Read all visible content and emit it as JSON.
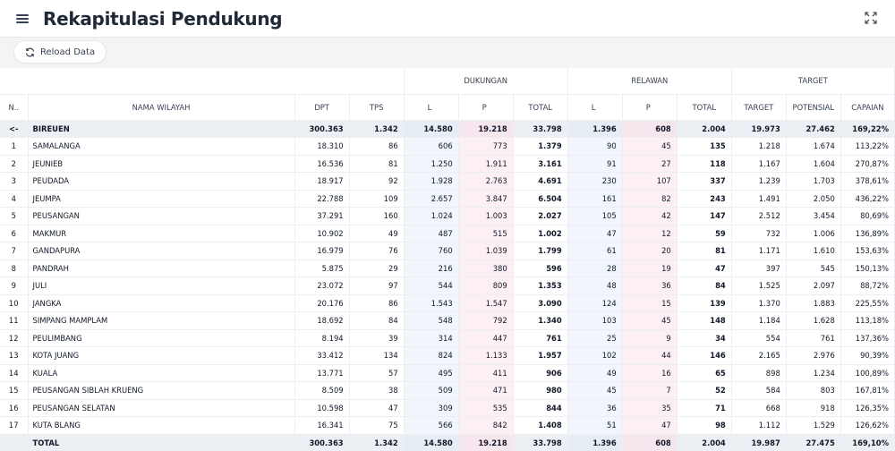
{
  "header": {
    "title": "Rekapitulasi Pendukung"
  },
  "toolbar": {
    "reload_label": "Reload Data"
  },
  "table": {
    "groups": {
      "dukungan": "DUKUNGAN",
      "relawan": "RELAWAN",
      "target": "TARGET"
    },
    "columns": {
      "no": "N..",
      "nama": "NAMA WILAYAH",
      "dpt": "DPT",
      "tps": "TPS",
      "d_l": "L",
      "d_p": "P",
      "d_total": "TOTAL",
      "r_l": "L",
      "r_p": "P",
      "r_total": "TOTAL",
      "target": "TARGET",
      "potensial": "POTENSIAL",
      "capaian": "CAPAIAN"
    },
    "group_row": {
      "toggle": "<-",
      "name": "BIREUEN",
      "dpt": "300.363",
      "tps": "1.342",
      "d_l": "14.580",
      "d_p": "19.218",
      "d_total": "33.798",
      "r_l": "1.396",
      "r_p": "608",
      "r_total": "2.004",
      "target": "19.973",
      "potensial": "27.462",
      "capaian": "169,22%"
    },
    "rows": [
      {
        "no": "1",
        "name": "SAMALANGA",
        "dpt": "18.310",
        "tps": "86",
        "d_l": "606",
        "d_p": "773",
        "d_total": "1.379",
        "r_l": "90",
        "r_p": "45",
        "r_total": "135",
        "target": "1.218",
        "potensial": "1.674",
        "capaian": "113,22%"
      },
      {
        "no": "2",
        "name": "JEUNIEB",
        "dpt": "16.536",
        "tps": "81",
        "d_l": "1.250",
        "d_p": "1.911",
        "d_total": "3.161",
        "r_l": "91",
        "r_p": "27",
        "r_total": "118",
        "target": "1.167",
        "potensial": "1.604",
        "capaian": "270,87%"
      },
      {
        "no": "3",
        "name": "PEUDADA",
        "dpt": "18.917",
        "tps": "92",
        "d_l": "1.928",
        "d_p": "2.763",
        "d_total": "4.691",
        "r_l": "230",
        "r_p": "107",
        "r_total": "337",
        "target": "1.239",
        "potensial": "1.703",
        "capaian": "378,61%"
      },
      {
        "no": "4",
        "name": "JEUMPA",
        "dpt": "22.788",
        "tps": "109",
        "d_l": "2.657",
        "d_p": "3.847",
        "d_total": "6.504",
        "r_l": "161",
        "r_p": "82",
        "r_total": "243",
        "target": "1.491",
        "potensial": "2.050",
        "capaian": "436,22%"
      },
      {
        "no": "5",
        "name": "PEUSANGAN",
        "dpt": "37.291",
        "tps": "160",
        "d_l": "1.024",
        "d_p": "1.003",
        "d_total": "2.027",
        "r_l": "105",
        "r_p": "42",
        "r_total": "147",
        "target": "2.512",
        "potensial": "3.454",
        "capaian": "80,69%"
      },
      {
        "no": "6",
        "name": "MAKMUR",
        "dpt": "10.902",
        "tps": "49",
        "d_l": "487",
        "d_p": "515",
        "d_total": "1.002",
        "r_l": "47",
        "r_p": "12",
        "r_total": "59",
        "target": "732",
        "potensial": "1.006",
        "capaian": "136,89%"
      },
      {
        "no": "7",
        "name": "GANDAPURA",
        "dpt": "16.979",
        "tps": "76",
        "d_l": "760",
        "d_p": "1.039",
        "d_total": "1.799",
        "r_l": "61",
        "r_p": "20",
        "r_total": "81",
        "target": "1.171",
        "potensial": "1.610",
        "capaian": "153,63%"
      },
      {
        "no": "8",
        "name": "PANDRAH",
        "dpt": "5.875",
        "tps": "29",
        "d_l": "216",
        "d_p": "380",
        "d_total": "596",
        "r_l": "28",
        "r_p": "19",
        "r_total": "47",
        "target": "397",
        "potensial": "545",
        "capaian": "150,13%"
      },
      {
        "no": "9",
        "name": "JULI",
        "dpt": "23.072",
        "tps": "97",
        "d_l": "544",
        "d_p": "809",
        "d_total": "1.353",
        "r_l": "48",
        "r_p": "36",
        "r_total": "84",
        "target": "1.525",
        "potensial": "2.097",
        "capaian": "88,72%"
      },
      {
        "no": "10",
        "name": "JANGKA",
        "dpt": "20.176",
        "tps": "86",
        "d_l": "1.543",
        "d_p": "1.547",
        "d_total": "3.090",
        "r_l": "124",
        "r_p": "15",
        "r_total": "139",
        "target": "1.370",
        "potensial": "1.883",
        "capaian": "225,55%"
      },
      {
        "no": "11",
        "name": "SIMPANG MAMPLAM",
        "dpt": "18.692",
        "tps": "84",
        "d_l": "548",
        "d_p": "792",
        "d_total": "1.340",
        "r_l": "103",
        "r_p": "45",
        "r_total": "148",
        "target": "1.184",
        "potensial": "1.628",
        "capaian": "113,18%"
      },
      {
        "no": "12",
        "name": "PEULIMBANG",
        "dpt": "8.194",
        "tps": "39",
        "d_l": "314",
        "d_p": "447",
        "d_total": "761",
        "r_l": "25",
        "r_p": "9",
        "r_total": "34",
        "target": "554",
        "potensial": "761",
        "capaian": "137,36%"
      },
      {
        "no": "13",
        "name": "KOTA JUANG",
        "dpt": "33.412",
        "tps": "134",
        "d_l": "824",
        "d_p": "1.133",
        "d_total": "1.957",
        "r_l": "102",
        "r_p": "44",
        "r_total": "146",
        "target": "2.165",
        "potensial": "2.976",
        "capaian": "90,39%"
      },
      {
        "no": "14",
        "name": "KUALA",
        "dpt": "13.771",
        "tps": "57",
        "d_l": "495",
        "d_p": "411",
        "d_total": "906",
        "r_l": "49",
        "r_p": "16",
        "r_total": "65",
        "target": "898",
        "potensial": "1.234",
        "capaian": "100,89%"
      },
      {
        "no": "15",
        "name": "PEUSANGAN SIBLAH KRUENG",
        "dpt": "8.509",
        "tps": "38",
        "d_l": "509",
        "d_p": "471",
        "d_total": "980",
        "r_l": "45",
        "r_p": "7",
        "r_total": "52",
        "target": "584",
        "potensial": "803",
        "capaian": "167,81%"
      },
      {
        "no": "16",
        "name": "PEUSANGAN SELATAN",
        "dpt": "10.598",
        "tps": "47",
        "d_l": "309",
        "d_p": "535",
        "d_total": "844",
        "r_l": "36",
        "r_p": "35",
        "r_total": "71",
        "target": "668",
        "potensial": "918",
        "capaian": "126,35%"
      },
      {
        "no": "17",
        "name": "KUTA BLANG",
        "dpt": "16.341",
        "tps": "75",
        "d_l": "566",
        "d_p": "842",
        "d_total": "1.408",
        "r_l": "51",
        "r_p": "47",
        "r_total": "98",
        "target": "1.112",
        "potensial": "1.529",
        "capaian": "126,62%"
      }
    ],
    "total_row": {
      "name": "TOTAL",
      "dpt": "300.363",
      "tps": "1.342",
      "d_l": "14.580",
      "d_p": "19.218",
      "d_total": "33.798",
      "r_l": "1.396",
      "r_p": "608",
      "r_total": "2.004",
      "target": "19.987",
      "potensial": "27.475",
      "capaian": "169,10%"
    }
  },
  "icons": {
    "menu": "menu-icon",
    "reload": "reload-icon",
    "expand": "expand-icon"
  },
  "colors": {
    "tint_l": "#f0f6fc",
    "tint_p": "#fdf0f5",
    "group_bg": "#eceff3"
  }
}
